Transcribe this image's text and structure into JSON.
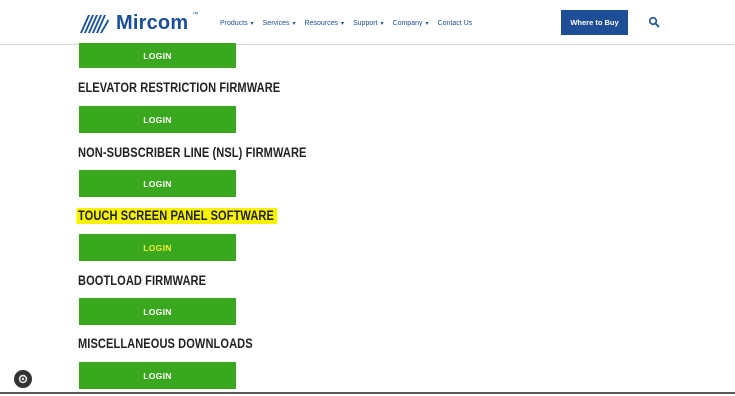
{
  "brand": {
    "name": "Mircom",
    "tm": "™"
  },
  "nav": {
    "items": [
      {
        "label": "Products",
        "caret": "▾"
      },
      {
        "label": "Services",
        "caret": "▾"
      },
      {
        "label": "Resources",
        "caret": "▾"
      },
      {
        "label": "Support",
        "caret": "▾"
      },
      {
        "label": "Company",
        "caret": "▾"
      },
      {
        "label": "Contact Us",
        "caret": ""
      }
    ],
    "cta_label": "Where to Buy",
    "search_icon": "search-icon"
  },
  "sections": [
    {
      "title": "",
      "button": "LOGIN",
      "highlighted": false
    },
    {
      "title": "ELEVATOR RESTRICTION FIRMWARE",
      "button": "LOGIN",
      "highlighted": false
    },
    {
      "title": "NON-SUBSCRIBER LINE (NSL) FIRMWARE",
      "button": "LOGIN",
      "highlighted": false
    },
    {
      "title": "TOUCH SCREEN PANEL SOFTWARE",
      "button": "LOGIN",
      "highlighted": true
    },
    {
      "title": "BOOTLOAD FIRMWARE",
      "button": "LOGIN",
      "highlighted": false
    },
    {
      "title": "MISCELLANEOUS DOWNLOADS",
      "button": "LOGIN",
      "highlighted": false
    }
  ],
  "colors": {
    "brand_blue": "#1a4f97",
    "login_green": "#3aa81e",
    "highlight_yellow": "#f7f300"
  },
  "widgets": {
    "settings_icon": "gear-icon"
  }
}
